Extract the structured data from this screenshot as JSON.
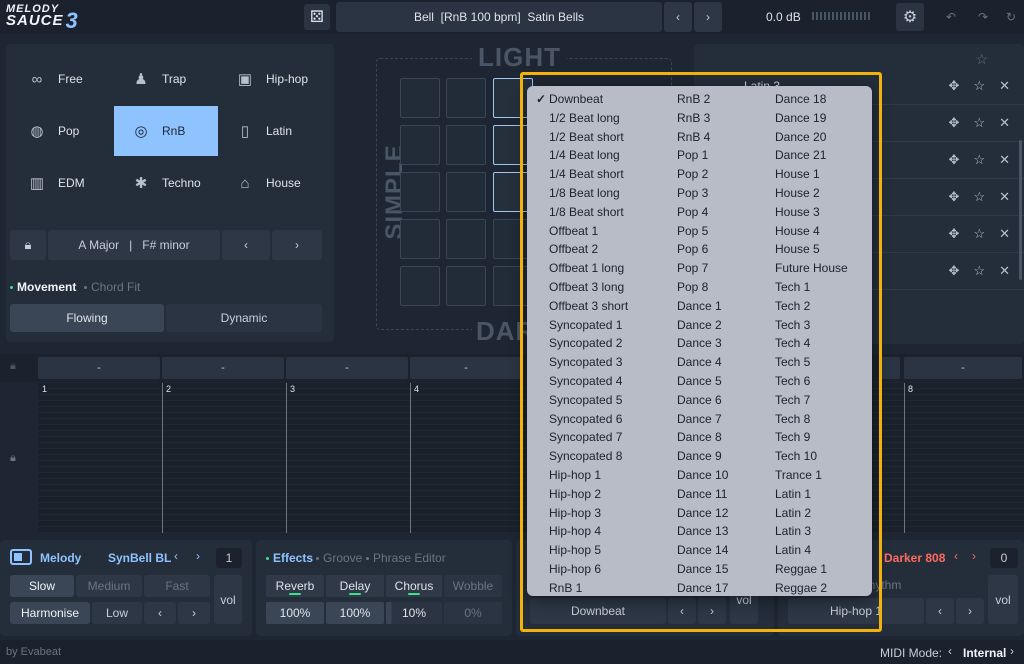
{
  "app": {
    "logo_line1": "MELODY",
    "logo_line2": "SAUCE",
    "logo_version": "3",
    "footer_brand": "by Evabeat"
  },
  "topbar": {
    "preset": "Bell  [RnB 100 bpm]  Satin Bells",
    "volume": "0.0 dB"
  },
  "genres": [
    {
      "label": "Free",
      "icon": "infinity-icon"
    },
    {
      "label": "Trap",
      "icon": "hood-figure-icon"
    },
    {
      "label": "Hip-hop",
      "icon": "boombox-icon"
    },
    {
      "label": "Pop",
      "icon": "lollipop-icon"
    },
    {
      "label": "RnB",
      "icon": "vinyl-icon",
      "selected": true
    },
    {
      "label": "Latin",
      "icon": "speaker-icon"
    },
    {
      "label": "EDM",
      "icon": "equalizer-icon"
    },
    {
      "label": "Techno",
      "icon": "butterfly-icon"
    },
    {
      "label": "House",
      "icon": "house-keys-icon"
    }
  ],
  "key": {
    "major": "A Major",
    "minor": "F# minor"
  },
  "movement": {
    "tab_active": "Movement",
    "tab_inactive": "Chord Fit",
    "flowing": "Flowing",
    "dynamic": "Dynamic"
  },
  "xy": {
    "top": "LIGHT",
    "left": "SIMPLE",
    "bottom": "DARK"
  },
  "playlist": {
    "row1": "Latin 3"
  },
  "chords": {
    "slots": [
      "-",
      "-",
      "-",
      "-",
      "-",
      "-",
      "-",
      "-"
    ]
  },
  "timeline": {
    "bars": [
      "1",
      "2",
      "3",
      "4",
      "8"
    ]
  },
  "melody": {
    "title": "Melody",
    "instrument": "SynBell BL",
    "octave": "1",
    "speed": [
      "Slow",
      "Medium",
      "Fast"
    ],
    "harmonise": "Harmonise",
    "harmonise_value": "Low",
    "vol": "vol"
  },
  "effects": {
    "tabs": [
      "Effects",
      "Groove",
      "Phrase Editor"
    ],
    "names": [
      "Reverb",
      "Delay",
      "Chorus",
      "Wobble"
    ],
    "values": [
      "100%",
      "100%",
      "10%",
      "0%"
    ]
  },
  "groove": {
    "rhythm": "Downbeat",
    "vol": "vol"
  },
  "bass": {
    "instrument": "Darker 808",
    "octave": "0",
    "rhythm_label": "Rhythm",
    "rhythm": "Hip-hop 1",
    "vol": "vol"
  },
  "midi": {
    "label": "MIDI Mode:",
    "value": "Internal"
  },
  "menu": {
    "selected": "Downbeat",
    "col1": [
      "Downbeat",
      "1/2 Beat long",
      "1/2 Beat short",
      "1/4 Beat long",
      "1/4 Beat short",
      "1/8 Beat long",
      "1/8 Beat short",
      "Offbeat 1",
      "Offbeat 2",
      "Offbeat 1 long",
      "Offbeat 3 long",
      "Offbeat 3 short",
      "Syncopated 1",
      "Syncopated 2",
      "Syncopated 3",
      "Syncopated 4",
      "Syncopated 5",
      "Syncopated 6",
      "Syncopated 7",
      "Syncopated 8",
      "Hip-hop 1",
      "Hip-hop 2",
      "Hip-hop 3",
      "Hip-hop 4",
      "Hip-hop 5",
      "Hip-hop 6",
      "RnB 1"
    ],
    "col2": [
      "RnB 2",
      "RnB 3",
      "RnB 4",
      "Pop 1",
      "Pop 2",
      "Pop 3",
      "Pop 4",
      "Pop 5",
      "Pop 6",
      "Pop 7",
      "Pop 8",
      "Dance 1",
      "Dance 2",
      "Dance 3",
      "Dance 4",
      "Dance 5",
      "Dance 6",
      "Dance 7",
      "Dance 8",
      "Dance 9",
      "Dance 10",
      "Dance 11",
      "Dance 12",
      "Dance 13",
      "Dance 14",
      "Dance 15",
      "Dance 17"
    ],
    "col3": [
      "Dance 18",
      "Dance 19",
      "Dance 20",
      "Dance 21",
      "House 1",
      "House 2",
      "House 3",
      "House 4",
      "House 5",
      "Future House",
      "Tech 1",
      "Tech 2",
      "Tech 3",
      "Tech 4",
      "Tech 5",
      "Tech 6",
      "Tech 7",
      "Tech 8",
      "Tech 9",
      "Tech 10",
      "Trance 1",
      "Latin 1",
      "Latin 2",
      "Latin 3",
      "Latin 4",
      "Reggae 1",
      "Reggae 2"
    ]
  },
  "colors": {
    "accent": "#8ec3ff",
    "bass_accent": "#ff6b5e",
    "highlight_frame": "#f2b20a",
    "active_green": "#3ee08f"
  }
}
